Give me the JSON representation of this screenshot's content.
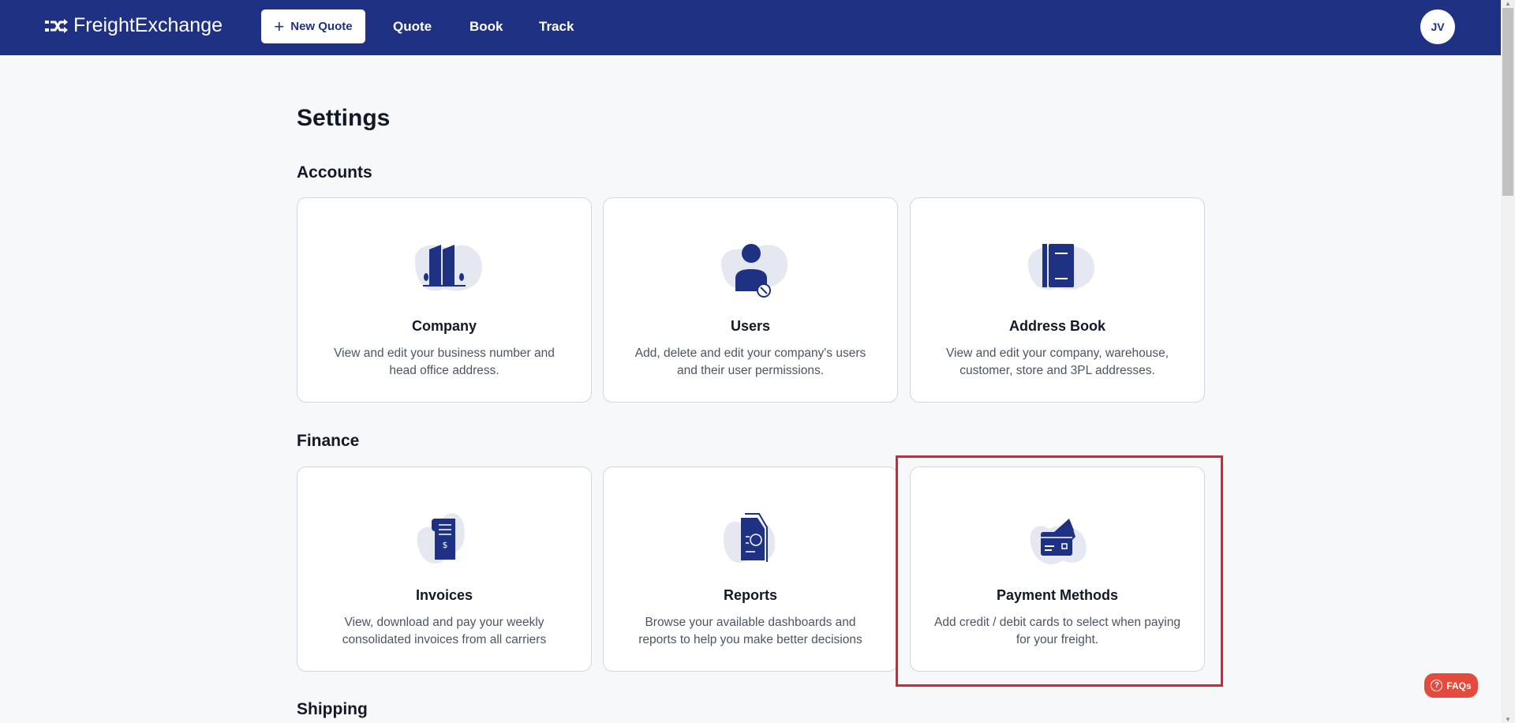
{
  "header": {
    "logo": "FreightExchange",
    "new_quote": "New Quote",
    "nav": [
      "Quote",
      "Book",
      "Track"
    ],
    "avatar": "JV"
  },
  "page": {
    "title": "Settings"
  },
  "sections": [
    {
      "title": "Accounts",
      "cards": [
        {
          "title": "Company",
          "desc": "View and edit your business number and head office address.",
          "icon": "building-icon"
        },
        {
          "title": "Users",
          "desc": "Add, delete and edit your company's users and their user permissions.",
          "icon": "user-settings-icon"
        },
        {
          "title": "Address Book",
          "desc": "View and edit your company, warehouse, customer, store and 3PL addresses.",
          "icon": "address-book-icon"
        }
      ]
    },
    {
      "title": "Finance",
      "cards": [
        {
          "title": "Invoices",
          "desc": "View, download and pay your weekly consolidated invoices from all carriers",
          "icon": "invoice-icon"
        },
        {
          "title": "Reports",
          "desc": "Browse your available dashboards and reports to help you make better decisions",
          "icon": "report-icon"
        },
        {
          "title": "Payment Methods",
          "desc": "Add credit / debit cards to select when paying for your freight.",
          "icon": "credit-card-icon"
        }
      ]
    },
    {
      "title": "Shipping"
    }
  ],
  "faq": "FAQs",
  "colors": {
    "brand": "#1f3182",
    "highlight": "#e0202a",
    "faq": "#e54b3c"
  }
}
